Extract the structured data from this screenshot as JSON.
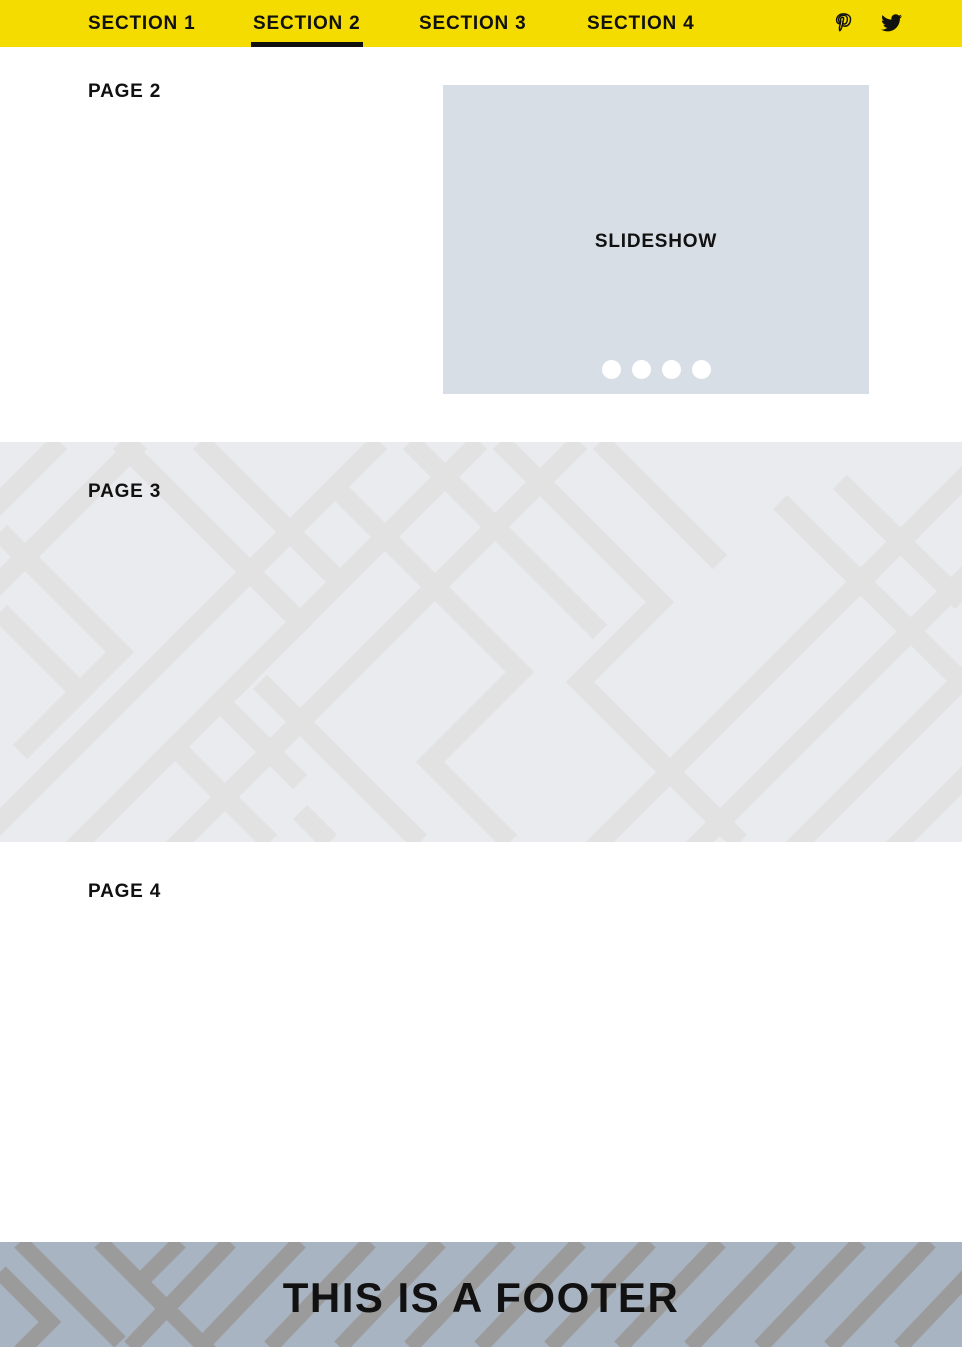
{
  "nav": {
    "items": [
      {
        "label": "SECTION 1",
        "active": false
      },
      {
        "label": "SECTION 2",
        "active": true
      },
      {
        "label": "SECTION 3",
        "active": false
      },
      {
        "label": "SECTION 4",
        "active": false
      }
    ],
    "icons": [
      "pinterest-icon",
      "twitter-icon"
    ],
    "background_color": "#f5dc00"
  },
  "page2": {
    "label": "PAGE 2",
    "slideshow": {
      "label": "SLIDESHOW",
      "dot_count": 4,
      "background_color": "#d8dee5"
    }
  },
  "page3": {
    "label": "PAGE 3",
    "pattern_colors": [
      "#eaebee",
      "#e2e2e2"
    ]
  },
  "page4": {
    "label": "PAGE 4"
  },
  "footer": {
    "text": "THIS IS A FOOTER",
    "pattern_colors": [
      "#a9b4c2",
      "#9b9b9b"
    ]
  }
}
